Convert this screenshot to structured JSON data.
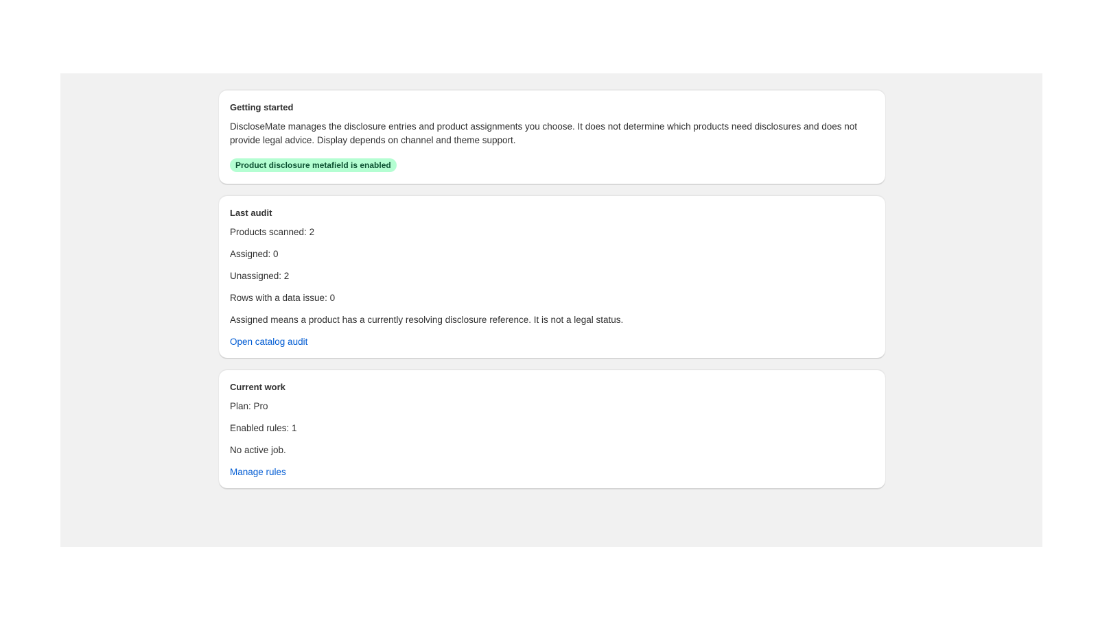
{
  "getting_started": {
    "title": "Getting started",
    "description": "DiscloseMate manages the disclosure entries and product assignments you choose. It does not determine which products need disclosures and does not provide legal advice. Display depends on channel and theme support.",
    "badge": "Product disclosure metafield is enabled",
    "badge_color": "#b4fed2"
  },
  "last_audit": {
    "title": "Last audit",
    "products_scanned": "Products scanned: 2",
    "assigned": "Assigned: 0",
    "unassigned": "Unassigned: 2",
    "rows_with_issue": "Rows with a data issue: 0",
    "note": "Assigned means a product has a currently resolving disclosure reference. It is not a legal status.",
    "link_label": "Open catalog audit"
  },
  "current_work": {
    "title": "Current work",
    "plan": "Plan: Pro",
    "enabled_rules": "Enabled rules: 1",
    "job_status": "No active job.",
    "link_label": "Manage rules"
  },
  "colors": {
    "link": "#005bd3",
    "background": "#f1f1f1",
    "card": "#ffffff"
  }
}
